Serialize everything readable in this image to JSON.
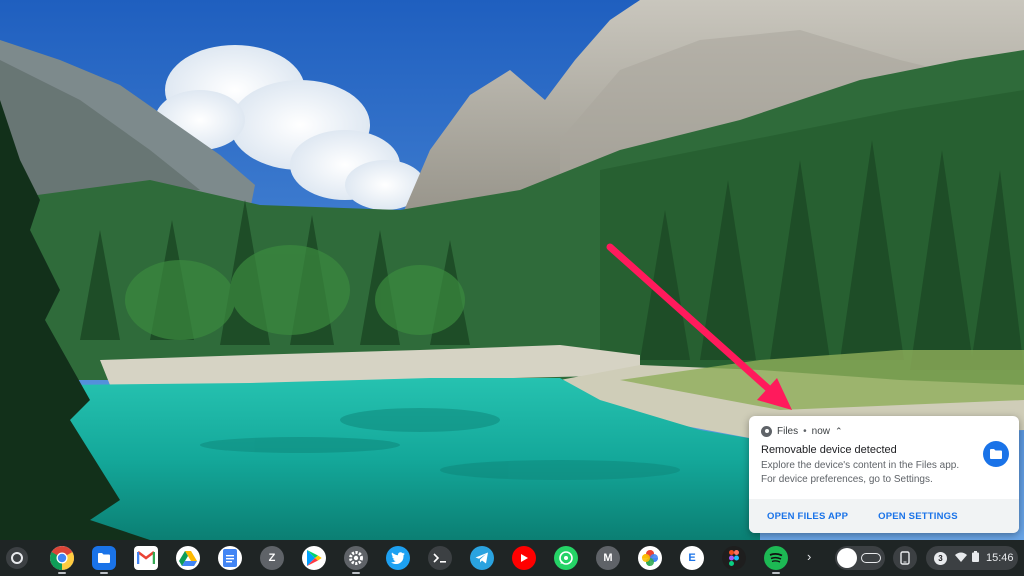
{
  "notification": {
    "app_name": "Files",
    "separator": "•",
    "time": "now",
    "title": "Removable device detected",
    "body": "Explore the device's content in the Files app. For device preferences, go to Settings.",
    "actions": {
      "open_files": "OPEN FILES APP",
      "open_settings": "OPEN SETTINGS"
    },
    "accent_color": "#1a73e8"
  },
  "annotation": {
    "arrow_color": "#ff1a5c"
  },
  "shelf": {
    "launcher_icon": "launcher-circle-icon",
    "apps": [
      {
        "name": "chrome-icon",
        "running": true
      },
      {
        "name": "files-icon",
        "running": true
      },
      {
        "name": "gmail-icon",
        "running": false
      },
      {
        "name": "google-drive-icon",
        "running": false
      },
      {
        "name": "google-docs-icon",
        "running": false
      },
      {
        "name": "zoom-icon",
        "letter": "Z",
        "running": false
      },
      {
        "name": "play-store-icon",
        "running": false
      },
      {
        "name": "settings-icon",
        "running": true
      },
      {
        "name": "twitter-icon",
        "running": false
      },
      {
        "name": "terminal-icon",
        "running": false
      },
      {
        "name": "telegram-icon",
        "running": false
      },
      {
        "name": "youtube-icon",
        "running": false
      },
      {
        "name": "whatsapp-icon",
        "running": false
      },
      {
        "name": "mail-m-icon",
        "letter": "M",
        "running": false
      },
      {
        "name": "photos-icon",
        "running": false
      },
      {
        "name": "e-app-icon",
        "letter": "E",
        "running": false
      },
      {
        "name": "figma-icon",
        "running": false
      },
      {
        "name": "spotify-icon",
        "running": false
      }
    ],
    "overflow_icon": "chevron-right-icon",
    "notification_count": "3",
    "clock": "15:46"
  }
}
